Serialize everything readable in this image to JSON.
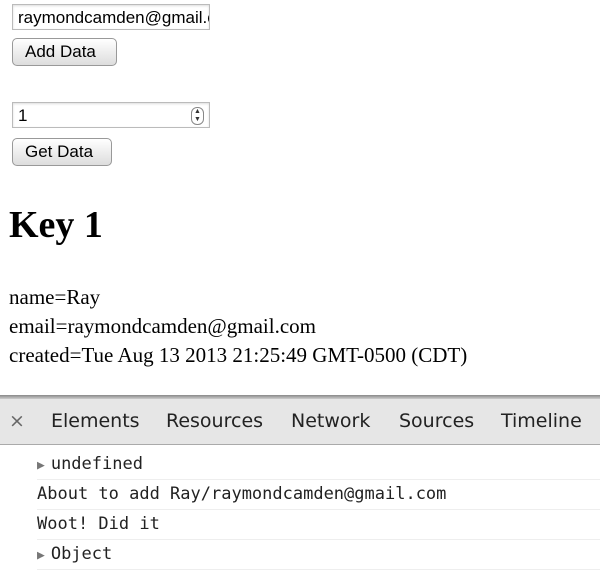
{
  "form": {
    "email_value": "raymondcamden@gmail.com",
    "add_label": "Add Data",
    "key_value": "1",
    "get_label": "Get Data"
  },
  "result": {
    "heading": "Key 1",
    "lines": [
      "name=Ray",
      "email=raymondcamden@gmail.com",
      "created=Tue Aug 13 2013 21:25:49 GMT-0500 (CDT)"
    ]
  },
  "devtools": {
    "close": "×",
    "tabs": [
      "Elements",
      "Resources",
      "Network",
      "Sources",
      "Timeline"
    ],
    "console": [
      {
        "text": "undefined",
        "expandable": true
      },
      {
        "text": "About to add Ray/raymondcamden@gmail.com",
        "expandable": false
      },
      {
        "text": "Woot! Did it",
        "expandable": false
      },
      {
        "text": "Object",
        "expandable": true
      }
    ]
  }
}
